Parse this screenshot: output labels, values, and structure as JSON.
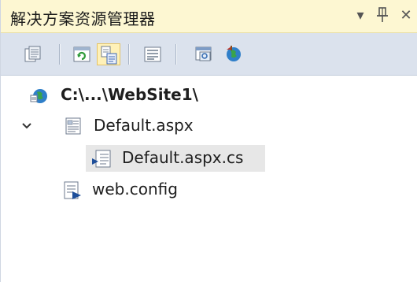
{
  "window": {
    "title": "解决方案资源管理器",
    "dropdown_glyph": "▾",
    "pin_glyph": "ᛘ",
    "close_glyph": "✕"
  },
  "toolbar": {
    "buttons": [
      {
        "name": "properties-icon",
        "active": false
      },
      {
        "name": "refresh-icon",
        "active": false
      },
      {
        "name": "nest-related-files-icon",
        "active": true
      },
      {
        "name": "view-code-icon",
        "active": false
      },
      {
        "name": "view-designer-icon",
        "active": false
      },
      {
        "name": "copy-website-icon",
        "active": false
      }
    ]
  },
  "tree": {
    "root": {
      "label": "C:\\...\\WebSite1\\",
      "icon": "website-globe-icon"
    },
    "items": [
      {
        "label": "Default.aspx",
        "icon": "aspx-page-icon",
        "expanded": true
      },
      {
        "label": "Default.aspx.cs",
        "icon": "cs-file-icon",
        "selected": true
      },
      {
        "label": "web.config",
        "icon": "config-file-icon"
      }
    ]
  },
  "colors": {
    "title_bg": "#fdf7d2",
    "toolbar_bg": "#dbe2ed",
    "active_button_bg": "#fff1b8",
    "selection_bg": "#e7e7e7"
  }
}
